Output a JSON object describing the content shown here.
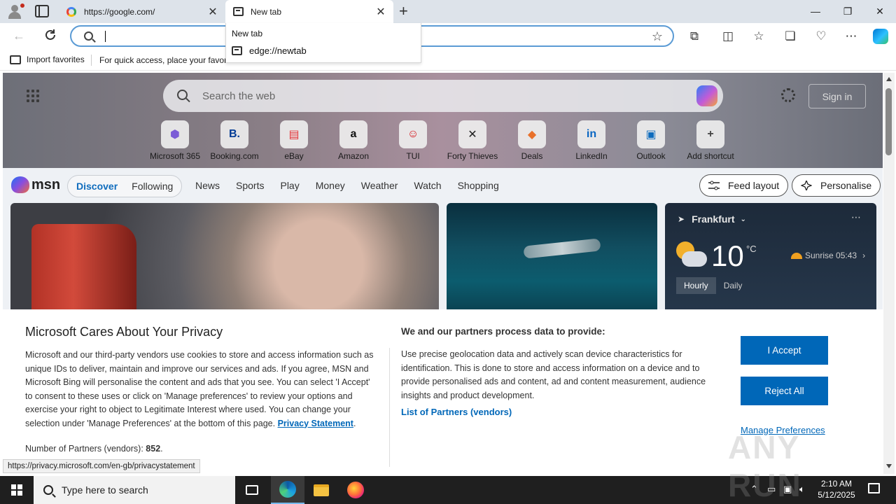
{
  "browser": {
    "tabs": [
      {
        "title": "https://google.com/"
      },
      {
        "title": "New tab"
      }
    ],
    "address": {
      "value": "",
      "placeholder": ""
    },
    "dropdown": {
      "header": "New tab",
      "item": "edge://newtab"
    },
    "favorites_bar": {
      "import_label": "Import favorites",
      "hint": "For quick access, place your favori"
    },
    "status_url": "https://privacy.microsoft.com/en-gb/privacystatement"
  },
  "newtab": {
    "search_placeholder": "Search the web",
    "sign_in": "Sign in",
    "shortcuts": [
      {
        "label": "Microsoft 365",
        "glyph": "⬢",
        "color": "#7b5cd6"
      },
      {
        "label": "Booking.com",
        "glyph": "B.",
        "color": "#003b95"
      },
      {
        "label": "eBay",
        "glyph": "▤",
        "color": "#e53238"
      },
      {
        "label": "Amazon",
        "glyph": "a",
        "color": "#111111"
      },
      {
        "label": "TUI",
        "glyph": "☺",
        "color": "#d40e14"
      },
      {
        "label": "Forty Thieves",
        "glyph": "✕",
        "color": "#222222"
      },
      {
        "label": "Deals",
        "glyph": "◆",
        "color": "#e8702a"
      },
      {
        "label": "LinkedIn",
        "glyph": "in",
        "color": "#0a66c2"
      },
      {
        "label": "Outlook",
        "glyph": "▣",
        "color": "#0f6cbd"
      },
      {
        "label": "Add shortcut",
        "glyph": "+",
        "color": "#444444"
      }
    ],
    "msn": {
      "logo": "msn",
      "feed_tabs": [
        "Discover",
        "Following"
      ],
      "nav": [
        "News",
        "Sports",
        "Play",
        "Money",
        "Weather",
        "Watch",
        "Shopping"
      ],
      "feed_layout": "Feed layout",
      "personalise": "Personalise"
    },
    "weather": {
      "location": "Frankfurt",
      "temperature": "10",
      "unit": "°C",
      "sunrise": "Sunrise 05:43",
      "modes": [
        "Hourly",
        "Daily"
      ]
    }
  },
  "privacy": {
    "title": "Microsoft Cares About Your Privacy",
    "body": "Microsoft and our third-party vendors use cookies to store and access information such as unique IDs to deliver, maintain and improve our services and ads. If you agree, MSN and Microsoft Bing will personalise the content and ads that you see. You can select 'I Accept' to consent to these uses or click on 'Manage preferences' to review your options and exercise your right to object to Legitimate Interest where used.  You can change your selection under 'Manage Preferences' at the bottom of this page.",
    "privacy_link": "Privacy Statement",
    "partners_label": "Number of Partners (vendors):",
    "partners_count": "852",
    "right_title": "We and our partners process data to provide:",
    "right_body": "Use precise geolocation data and actively scan device characteristics for identification. This is done to store and access information on a device and to provide personalised ads and content, ad and content measurement, audience insights and product development.",
    "list_partners": "List of Partners (vendors)",
    "accept": "I Accept",
    "reject": "Reject All",
    "manage": "Manage Preferences",
    "watermark": "ANY RUN"
  },
  "taskbar": {
    "search_text": "Type here to search",
    "time": "2:10 AM",
    "date": "5/12/2025"
  }
}
